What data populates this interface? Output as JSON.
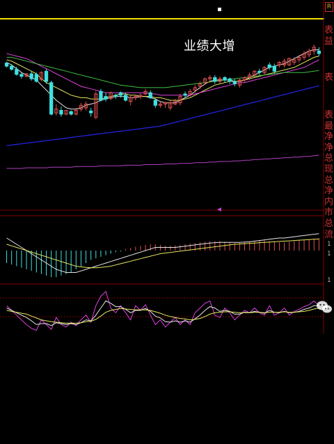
{
  "annotation": {
    "headline": "业绩大增"
  },
  "right_column": {
    "box_label": "R",
    "upper_chars": [
      "表",
      "益"
    ],
    "mid_chars": [
      "表"
    ],
    "lower_chars": [
      "表",
      "最",
      "净",
      "净",
      "总",
      "现",
      "总",
      "净",
      "内",
      "市",
      "总",
      "流"
    ],
    "macd_tick_labels": [
      "1",
      "1",
      "1"
    ]
  },
  "colors": {
    "background": "#000000",
    "up_candle": "#e05050",
    "down_candle": "#40e0e0",
    "ma_white": "#e8e8e8",
    "ma_yellow": "#e8e860",
    "ma_magenta": "#e040e0",
    "ma_green": "#40c040",
    "ma_blue": "#2020d0",
    "ma_purple": "#b040c0",
    "divider": "#800000",
    "top_line": "#f0e000"
  },
  "chart_data": [
    {
      "type": "candlestick",
      "title": "",
      "ylim": [
        0,
        300
      ],
      "x": [
        1,
        2,
        3,
        4,
        5,
        6,
        7,
        8,
        9,
        10,
        11,
        12,
        13,
        14,
        15,
        16,
        17,
        18,
        19,
        20,
        21,
        22,
        23,
        24,
        25,
        26,
        27,
        28,
        29,
        30,
        31,
        32,
        33,
        34,
        35,
        36,
        37,
        38,
        39,
        40,
        41,
        42,
        43,
        44,
        45,
        46,
        47,
        48,
        49,
        50,
        51,
        52,
        53,
        54,
        55,
        56,
        57,
        58,
        59,
        60,
        61,
        62,
        63,
        64
      ],
      "open": [
        231,
        226,
        221,
        213,
        210,
        214,
        213,
        205,
        218,
        200,
        152,
        156,
        150,
        154,
        150,
        158,
        160,
        155,
        145,
        186,
        178,
        175,
        180,
        184,
        180,
        170,
        176,
        178,
        182,
        184,
        172,
        164,
        166,
        160,
        166,
        168,
        182,
        182,
        188,
        194,
        200,
        206,
        208,
        202,
        208,
        206,
        202,
        196,
        204,
        208,
        212,
        218,
        216,
        228,
        226,
        228,
        228,
        228,
        232,
        236,
        240,
        244,
        250,
        250
      ],
      "close": [
        226,
        221,
        213,
        210,
        214,
        206,
        202,
        216,
        202,
        150,
        158,
        150,
        156,
        150,
        156,
        164,
        166,
        152,
        182,
        172,
        174,
        184,
        178,
        180,
        172,
        176,
        178,
        180,
        186,
        176,
        164,
        166,
        168,
        168,
        170,
        178,
        180,
        186,
        192,
        198,
        206,
        208,
        202,
        206,
        204,
        202,
        198,
        204,
        208,
        212,
        218,
        216,
        224,
        224,
        218,
        232,
        234,
        238,
        236,
        240,
        246,
        250,
        256,
        246
      ],
      "high": [
        233,
        229,
        225,
        216,
        215,
        218,
        216,
        218,
        222,
        203,
        166,
        162,
        156,
        156,
        160,
        168,
        170,
        160,
        186,
        190,
        184,
        186,
        182,
        186,
        184,
        180,
        180,
        183,
        190,
        188,
        175,
        170,
        170,
        172,
        174,
        182,
        186,
        190,
        196,
        202,
        208,
        212,
        212,
        210,
        210,
        208,
        206,
        206,
        210,
        216,
        220,
        222,
        226,
        232,
        230,
        234,
        238,
        240,
        240,
        244,
        250,
        254,
        260,
        256
      ],
      "low": [
        224,
        219,
        211,
        206,
        208,
        203,
        200,
        202,
        198,
        148,
        148,
        146,
        148,
        148,
        148,
        154,
        156,
        146,
        142,
        170,
        170,
        172,
        174,
        176,
        170,
        164,
        172,
        174,
        180,
        174,
        160,
        160,
        160,
        156,
        164,
        164,
        176,
        178,
        184,
        190,
        196,
        200,
        198,
        198,
        200,
        198,
        194,
        192,
        200,
        204,
        208,
        212,
        212,
        220,
        214,
        224,
        224,
        226,
        228,
        232,
        236,
        240,
        244,
        242
      ]
    },
    {
      "type": "line",
      "series": [
        {
          "values": [
            232,
            228,
            222,
            216,
            212,
            208,
            204,
            196,
            188,
            180,
            172,
            166,
            160,
            158,
            158,
            160,
            164,
            166,
            168,
            172,
            174,
            176,
            178,
            178,
            178,
            176,
            176,
            178,
            178,
            176,
            174,
            170,
            168,
            168,
            168,
            172,
            176,
            180,
            186,
            192,
            198,
            202,
            204,
            204,
            204,
            204,
            202,
            202,
            204,
            208,
            212,
            216,
            220,
            224,
            226,
            228,
            230,
            234,
            238,
            242,
            246,
            250,
            252,
            252
          ]
        },
        {
          "values": [
            236,
            234,
            230,
            226,
            222,
            218,
            214,
            206,
            200,
            196,
            192,
            188,
            184,
            180,
            178,
            176,
            176,
            174,
            174,
            174,
            176,
            178,
            180,
            182,
            182,
            180,
            180,
            178,
            178,
            178,
            176,
            176,
            174,
            172,
            172,
            172,
            174,
            176,
            180,
            184,
            188,
            192,
            196,
            198,
            200,
            202,
            202,
            202,
            204,
            206,
            208,
            210,
            212,
            214,
            216,
            218,
            220,
            222,
            224,
            228,
            232,
            236,
            240,
            242
          ]
        },
        {
          "values": [
            246,
            244,
            242,
            240,
            238,
            234,
            230,
            226,
            222,
            218,
            214,
            210,
            206,
            202,
            198,
            194,
            192,
            190,
            188,
            186,
            184,
            184,
            184,
            184,
            184,
            184,
            184,
            184,
            184,
            182,
            182,
            180,
            180,
            180,
            180,
            180,
            180,
            180,
            182,
            184,
            186,
            188,
            190,
            192,
            194,
            196,
            198,
            200,
            200,
            202,
            204,
            206,
            208,
            210,
            212,
            214,
            216,
            218,
            220,
            222,
            224,
            228,
            232,
            236
          ]
        },
        {
          "values": [
            240,
            240,
            238,
            236,
            234,
            232,
            230,
            228,
            226,
            224,
            222,
            220,
            218,
            216,
            214,
            212,
            210,
            208,
            206,
            204,
            202,
            200,
            198,
            196,
            195,
            194,
            193,
            192,
            192,
            192,
            192,
            192,
            192,
            193,
            194,
            195,
            196,
            197,
            198,
            199,
            200,
            201,
            202,
            203,
            204,
            205,
            206,
            207,
            208,
            209,
            210,
            211,
            212,
            213,
            214,
            215,
            216,
            216,
            216,
            216,
            216,
            217,
            218,
            219
          ]
        },
        {
          "values": [
            100,
            101,
            102,
            103,
            104,
            105,
            106,
            107,
            108,
            109,
            110,
            111,
            112,
            113,
            114,
            115,
            116,
            117,
            118,
            119,
            120,
            121,
            122,
            123,
            124,
            125,
            126,
            127,
            128,
            129,
            130,
            131,
            133,
            135,
            137,
            139,
            141,
            143,
            145,
            147,
            149,
            151,
            153,
            155,
            157,
            159,
            161,
            163,
            165,
            167,
            169,
            171,
            173,
            175,
            177,
            179,
            181,
            183,
            185,
            187,
            189,
            191,
            193,
            195
          ]
        },
        {
          "values": [
            64,
            64,
            64,
            64,
            65,
            65,
            65,
            65,
            65,
            66,
            66,
            66,
            66,
            66,
            67,
            67,
            67,
            67,
            67,
            68,
            68,
            68,
            68,
            68,
            69,
            69,
            69,
            69,
            70,
            70,
            70,
            70,
            71,
            71,
            71,
            72,
            72,
            72,
            73,
            73,
            73,
            74,
            74,
            75,
            75,
            75,
            76,
            76,
            77,
            77,
            78,
            78,
            79,
            79,
            80,
            80,
            81,
            81,
            82,
            82,
            83,
            83,
            84,
            85
          ]
        }
      ]
    },
    {
      "type": "bar",
      "ylim": [
        -10,
        10
      ],
      "values": [
        -4,
        -4.5,
        -5,
        -5.5,
        -6,
        -6.5,
        -7,
        -7.5,
        -8,
        -8.5,
        -8.5,
        -8,
        -7.5,
        -7,
        -6,
        -5,
        -4,
        -3,
        -2.5,
        -2,
        -1.5,
        -1,
        -0.5,
        -0.3,
        0.5,
        0.8,
        1.2,
        1.5,
        1.8,
        2,
        2,
        1.8,
        1.5,
        1.5,
        1.6,
        1.8,
        2,
        2.2,
        2.4,
        2.6,
        2.8,
        3,
        3,
        3,
        2.8,
        2.6,
        2.4,
        2.4,
        2.6,
        2.8,
        3,
        3.2,
        3.2,
        3,
        2.8,
        2.6,
        2.6,
        2.8,
        3,
        3.2,
        3.4,
        3.6,
        3.8,
        4
      ],
      "series": [
        {
          "values": [
            4,
            3,
            2,
            1,
            0,
            -1,
            -2,
            -3,
            -4,
            -5,
            -6,
            -6.5,
            -7,
            -7,
            -7,
            -6.5,
            -6,
            -5.5,
            -5,
            -4.5,
            -4,
            -3.5,
            -3,
            -2.5,
            -2,
            -1.5,
            -1,
            -0.5,
            0,
            0.5,
            1,
            1,
            1,
            1,
            1,
            1.2,
            1.4,
            1.6,
            1.8,
            2,
            2.2,
            2.4,
            2.5,
            2.6,
            2.6,
            2.6,
            2.6,
            2.6,
            2.7,
            2.8,
            3,
            3.2,
            3.4,
            3.6,
            3.8,
            4,
            4,
            4.2,
            4.4,
            4.6,
            4.8,
            5,
            5.2,
            5.4
          ]
        },
        {
          "values": [
            2,
            1.5,
            1,
            0.5,
            0,
            -0.5,
            -1,
            -1.5,
            -2,
            -2.5,
            -3,
            -3.5,
            -4,
            -4.5,
            -5,
            -5.2,
            -5.4,
            -5.5,
            -5.5,
            -5.4,
            -5.2,
            -5,
            -4.6,
            -4.2,
            -3.8,
            -3.4,
            -3,
            -2.6,
            -2.2,
            -1.8,
            -1.4,
            -1,
            -0.8,
            -0.6,
            -0.4,
            -0.2,
            0,
            0.2,
            0.4,
            0.6,
            0.8,
            1,
            1.2,
            1.4,
            1.6,
            1.8,
            2,
            2.1,
            2.2,
            2.3,
            2.4,
            2.5,
            2.6,
            2.7,
            2.8,
            2.9,
            3,
            3.1,
            3.2,
            3.3,
            3.4,
            3.5,
            3.6,
            3.7
          ]
        }
      ]
    },
    {
      "type": "line",
      "ylim": [
        0,
        100
      ],
      "series": [
        {
          "values": [
            60,
            50,
            40,
            30,
            20,
            12,
            8,
            30,
            20,
            10,
            35,
            20,
            15,
            25,
            18,
            30,
            40,
            25,
            60,
            80,
            90,
            55,
            45,
            60,
            45,
            30,
            60,
            50,
            62,
            40,
            20,
            30,
            15,
            25,
            35,
            20,
            30,
            20,
            45,
            55,
            65,
            70,
            40,
            35,
            55,
            45,
            30,
            40,
            50,
            45,
            55,
            45,
            40,
            60,
            40,
            45,
            55,
            40,
            48,
            52,
            58,
            62,
            70,
            60
          ]
        },
        {
          "values": [
            55,
            50,
            45,
            40,
            35,
            28,
            20,
            22,
            22,
            18,
            24,
            22,
            20,
            22,
            20,
            24,
            30,
            28,
            40,
            55,
            70,
            65,
            58,
            58,
            52,
            45,
            50,
            50,
            54,
            48,
            38,
            34,
            26,
            25,
            28,
            25,
            28,
            25,
            32,
            40,
            50,
            58,
            55,
            48,
            50,
            48,
            42,
            42,
            46,
            45,
            48,
            46,
            44,
            50,
            46,
            45,
            48,
            45,
            46,
            48,
            52,
            55,
            60,
            60
          ]
        },
        {
          "values": [
            50,
            48,
            46,
            44,
            42,
            38,
            34,
            30,
            28,
            26,
            25,
            24,
            23,
            23,
            23,
            24,
            26,
            27,
            31,
            38,
            46,
            50,
            52,
            54,
            53,
            52,
            51,
            51,
            51,
            50,
            47,
            44,
            40,
            37,
            35,
            33,
            32,
            30,
            31,
            33,
            37,
            42,
            45,
            46,
            47,
            47,
            46,
            45,
            45,
            45,
            46,
            46,
            45,
            46,
            46,
            46,
            47,
            46,
            46,
            47,
            48,
            50,
            53,
            55
          ]
        }
      ]
    }
  ]
}
